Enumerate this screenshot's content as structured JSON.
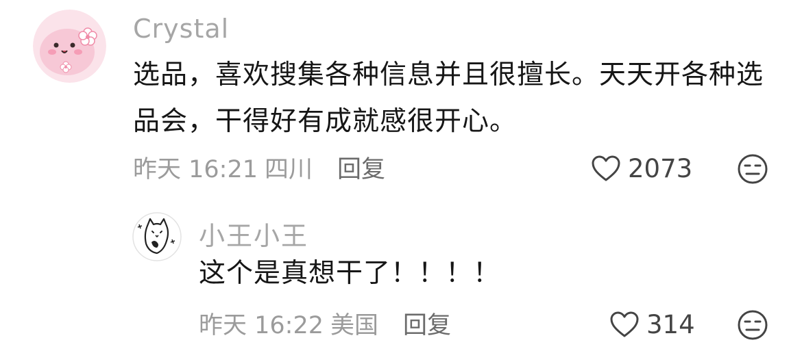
{
  "comments": [
    {
      "username": "Crystal",
      "content": "选品，喜欢搜集各种信息并且很擅长。天天开各种选品会，干得好有成就感很开心。",
      "time": "昨天 16:21",
      "location": "四川",
      "reply_label": "回复",
      "likes": "2073",
      "avatar_icon": "pink-cartoon-avatar",
      "like_icon": "heart-outline-icon",
      "dislike_icon": "unamused-face-icon"
    },
    {
      "username": "小王小王",
      "content": "这个是真想干了！！！！",
      "time": "昨天 16:22",
      "location": "美国",
      "reply_label": "回复",
      "likes": "314",
      "avatar_icon": "cat-sketch-avatar",
      "like_icon": "heart-outline-icon",
      "dislike_icon": "unamused-face-icon"
    }
  ],
  "colors": {
    "username": "#a6a6a6",
    "meta": "#9b9b9b",
    "reply": "#6b6b6b",
    "text": "#161616",
    "avatar_pink": "#f8d4df"
  }
}
